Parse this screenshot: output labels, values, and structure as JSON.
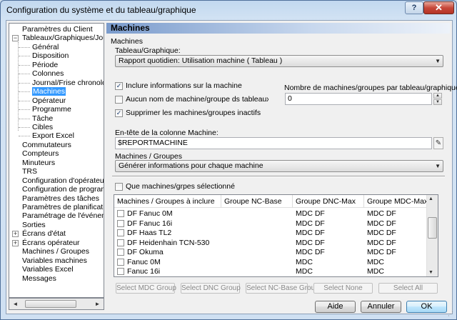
{
  "window": {
    "title": "Configuration du système et du tableau/graphique",
    "help_glyph": "?",
    "close_glyph": "✕"
  },
  "tree": {
    "items": [
      {
        "label": "Paramètres du Client",
        "level": 0,
        "expander": ""
      },
      {
        "label": "Tableaux/Graphiques/Journaux",
        "level": 0,
        "expander": "−"
      },
      {
        "label": "Général",
        "level": 1,
        "expander": ""
      },
      {
        "label": "Disposition",
        "level": 1,
        "expander": ""
      },
      {
        "label": "Période",
        "level": 1,
        "expander": ""
      },
      {
        "label": "Colonnes",
        "level": 1,
        "expander": ""
      },
      {
        "label": "Journal/Frise chronologique",
        "level": 1,
        "expander": ""
      },
      {
        "label": "Machines",
        "level": 1,
        "expander": "",
        "selected": true
      },
      {
        "label": "Opérateur",
        "level": 1,
        "expander": ""
      },
      {
        "label": "Programme",
        "level": 1,
        "expander": ""
      },
      {
        "label": "Tâche",
        "level": 1,
        "expander": ""
      },
      {
        "label": "Cibles",
        "level": 1,
        "expander": ""
      },
      {
        "label": "Export Excel",
        "level": 1,
        "expander": ""
      },
      {
        "label": "Commutateurs",
        "level": 0,
        "expander": ""
      },
      {
        "label": "Compteurs",
        "level": 0,
        "expander": ""
      },
      {
        "label": "Minuteurs",
        "level": 0,
        "expander": ""
      },
      {
        "label": "TRS",
        "level": 0,
        "expander": ""
      },
      {
        "label": "Configuration d'opérateur",
        "level": 0,
        "expander": ""
      },
      {
        "label": "Configuration de programme",
        "level": 0,
        "expander": ""
      },
      {
        "label": "Paramètres des tâches",
        "level": 0,
        "expander": ""
      },
      {
        "label": "Paramètres de planification",
        "level": 0,
        "expander": ""
      },
      {
        "label": "Paramétrage de l'événement",
        "level": 0,
        "expander": ""
      },
      {
        "label": "Sorties",
        "level": 0,
        "expander": ""
      },
      {
        "label": "Écrans d'état",
        "level": 0,
        "expander": "+"
      },
      {
        "label": "Écrans opérateur",
        "level": 0,
        "expander": "+"
      },
      {
        "label": "Machines / Groupes",
        "level": 0,
        "expander": ""
      },
      {
        "label": "Variables machines",
        "level": 0,
        "expander": ""
      },
      {
        "label": "Variables Excel",
        "level": 0,
        "expander": ""
      },
      {
        "label": "Messages",
        "level": 0,
        "expander": ""
      }
    ],
    "scroll_left": "◄",
    "scroll_right": "►"
  },
  "panel": {
    "heading": "Machines",
    "section_label": "Machines",
    "chart_label": "Tableau/Graphique:",
    "chart_value": "Rapport quotidien: Utilisation machine  ( Tableau )",
    "cb_include": {
      "label": "Inclure informations sur la machine",
      "checked": "✓"
    },
    "cb_noname": {
      "label": "Aucun nom de machine/groupe ds tableaux/graphiques",
      "checked": ""
    },
    "cb_remove": {
      "label": "Supprimer les machines/groupes inactifs",
      "checked": "✓"
    },
    "count_label": "Nombre de machines/groupes par tableau/graphique:",
    "count_value": "0",
    "header_label": "En-tête de la colonne Machine:",
    "header_value": "$REPORTMACHINE",
    "groups_label": "Machines / Groupes",
    "groups_value": "Générer informations pour chaque machine",
    "cb_selected": {
      "label": "Que machines/grpes sélectionné",
      "checked": ""
    }
  },
  "grid": {
    "columns": [
      "Machines / Groupes à inclure",
      "Groupe NC-Base",
      "Groupe DNC-Max",
      "Groupe MDC-Max"
    ],
    "rows": [
      {
        "name": "DF Fanuc 0M",
        "nc": "",
        "dnc": "MDC DF",
        "mdc": "MDC DF"
      },
      {
        "name": "DF Fanuc 16i",
        "nc": "",
        "dnc": "MDC DF",
        "mdc": "MDC DF"
      },
      {
        "name": "DF Haas TL2",
        "nc": "",
        "dnc": "MDC DF",
        "mdc": "MDC DF"
      },
      {
        "name": "DF Heidenhain TCN-530",
        "nc": "",
        "dnc": "MDC DF",
        "mdc": "MDC DF"
      },
      {
        "name": "DF Okuma",
        "nc": "",
        "dnc": "MDC DF",
        "mdc": "MDC DF"
      },
      {
        "name": "Fanuc 0M",
        "nc": "",
        "dnc": "MDC",
        "mdc": "MDC"
      },
      {
        "name": "Fanuc 16i",
        "nc": "",
        "dnc": "MDC",
        "mdc": "MDC"
      }
    ],
    "scroll_up": "▲",
    "scroll_down": "▼"
  },
  "group_buttons": [
    "Select MDC Group",
    "Select DNC Group",
    "Select NC-Base Group",
    "Select None",
    "Select All"
  ],
  "footer": {
    "help": "Aide",
    "cancel": "Annuler",
    "ok": "OK"
  }
}
